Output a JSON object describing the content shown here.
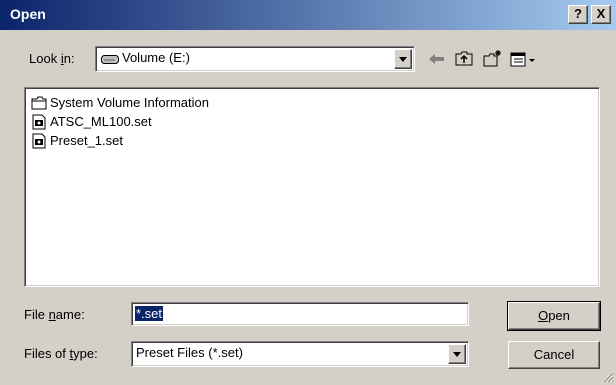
{
  "window": {
    "title": "Open",
    "help_label": "?",
    "close_label": "X"
  },
  "look_in": {
    "label_pre": "Look ",
    "label_underlined": "i",
    "label_post": "n:",
    "value": "Volume (E:)",
    "value_icon": "drive-icon"
  },
  "toolbar": {
    "icons": [
      "back-arrow-icon",
      "up-folder-icon",
      "new-folder-icon",
      "view-menu-icon"
    ]
  },
  "files": [
    {
      "name": "System Volume Information",
      "icon": "folder-icon"
    },
    {
      "name": "ATSC_ML100.set",
      "icon": "document-icon"
    },
    {
      "name": "Preset_1.set",
      "icon": "document-icon"
    }
  ],
  "file_name": {
    "label_pre": "File ",
    "label_underlined": "n",
    "label_post": "ame:",
    "value": "*.set"
  },
  "file_type": {
    "label_pre": "Files of ",
    "label_underlined": "t",
    "label_post": "ype:",
    "value": "Preset Files (*.set)"
  },
  "buttons": {
    "open_underlined": "O",
    "open_rest": "pen",
    "cancel": "Cancel"
  },
  "colors": {
    "titlebar_start": "#0a246a",
    "titlebar_end": "#a6caf0",
    "face": "#d4d0c8",
    "selection": "#0a246a"
  }
}
